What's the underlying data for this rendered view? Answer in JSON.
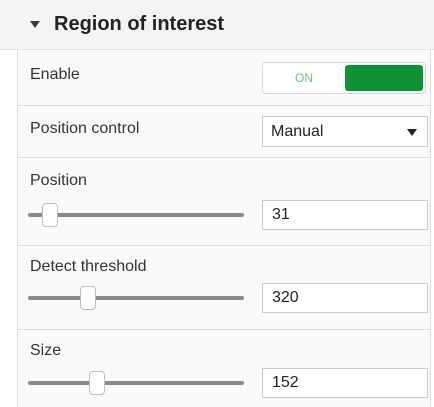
{
  "panel": {
    "title": "Region of interest"
  },
  "enable": {
    "label": "Enable",
    "state_label": "ON",
    "is_on": true,
    "active_color": "#0e9134"
  },
  "position_control": {
    "label": "Position control",
    "selected": "Manual"
  },
  "position": {
    "label": "Position",
    "value": "31",
    "slider_fraction": 0.1
  },
  "detect_threshold": {
    "label": "Detect threshold",
    "value": "320",
    "slider_fraction": 0.28
  },
  "size": {
    "label": "Size",
    "value": "152",
    "slider_fraction": 0.32
  }
}
